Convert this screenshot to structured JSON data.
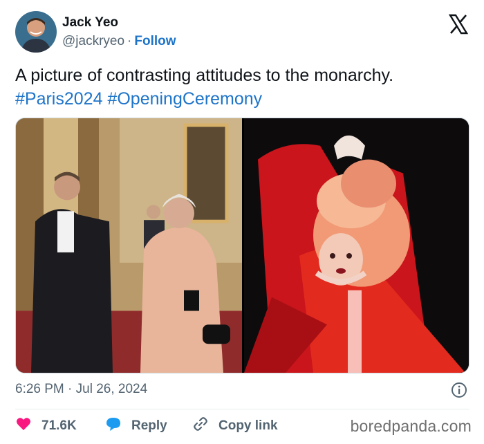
{
  "header": {
    "display_name": "Jack Yeo",
    "handle": "@jackryeo",
    "separator": "·",
    "follow_label": "Follow"
  },
  "tweet": {
    "text": "A picture of contrasting attitudes to the monarchy.",
    "hashtags": [
      "#Paris2024",
      "#OpeningCeremony"
    ]
  },
  "meta": {
    "time": "6:26 PM",
    "separator": "·",
    "date": "Jul 26, 2024"
  },
  "actions": {
    "likes": "71.6K",
    "reply_label": "Reply",
    "copy_label": "Copy link"
  },
  "watermark": "boredpanda.com",
  "icons": {
    "logo": "x-logo-icon",
    "info": "info-icon",
    "like": "heart-icon",
    "reply": "speech-bubble-icon",
    "copy": "link-icon"
  },
  "colors": {
    "link": "#1d74c9",
    "heart": "#f91880",
    "reply": "#1d9bf0",
    "text": "#0f1419",
    "muted": "#536471"
  }
}
